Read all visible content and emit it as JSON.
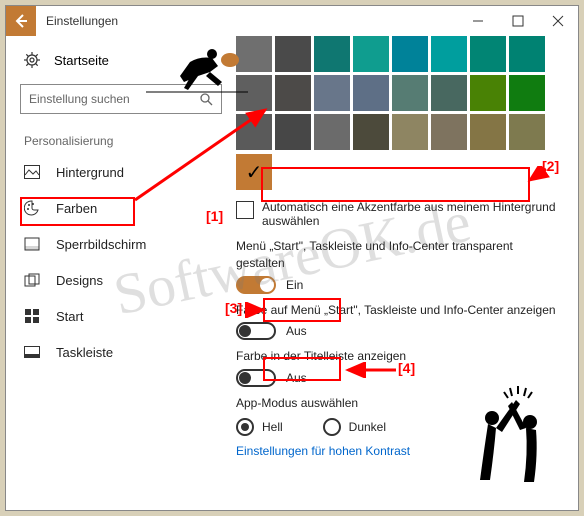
{
  "titlebar": {
    "title": "Einstellungen"
  },
  "sidebar": {
    "home": "Startseite",
    "search_placeholder": "Einstellung suchen",
    "section": "Personalisierung",
    "items": [
      {
        "label": "Hintergrund"
      },
      {
        "label": "Farben"
      },
      {
        "label": "Sperrbildschirm"
      },
      {
        "label": "Designs"
      },
      {
        "label": "Start"
      },
      {
        "label": "Taskleiste"
      }
    ]
  },
  "content": {
    "swatch_colors": [
      "#6F6F6F",
      "#4A4A4A",
      "#0F7771",
      "#0F9D8F",
      "#008299",
      "#009E9E",
      "#018574",
      "#008272",
      "#5F5F5F",
      "#4C4A48",
      "#68768A",
      "#5E6F86",
      "#567C73",
      "#486860",
      "#498205",
      "#107C10",
      "#5A5A5A",
      "#474747",
      "#6B6B6B",
      "#4C4A3B",
      "#8E8562",
      "#7E735F",
      "#847545",
      "#7E7A4F"
    ],
    "selected_color": "#C27A34",
    "auto_accent_label": "Automatisch eine Akzentfarbe aus meinem Hintergrund auswählen",
    "transparent_label": "Menü „Start\", Taskleiste und Info-Center transparent gestalten",
    "transparent_state": "Ein",
    "show_color_label": "Farbe auf Menü „Start\", Taskleiste und Info-Center anzeigen",
    "show_color_state": "Aus",
    "titlebar_color_label": "Farbe in der Titelleiste anzeigen",
    "titlebar_color_state": "Aus",
    "app_mode_label": "App-Modus auswählen",
    "radio_light": "Hell",
    "radio_dark": "Dunkel",
    "high_contrast_link": "Einstellungen für hohen Kontrast"
  },
  "annotations": {
    "a1": "[1]",
    "a2": "[2]",
    "a3": "[3]",
    "a4": "[4]"
  },
  "watermark": "SoftwareOK.de"
}
